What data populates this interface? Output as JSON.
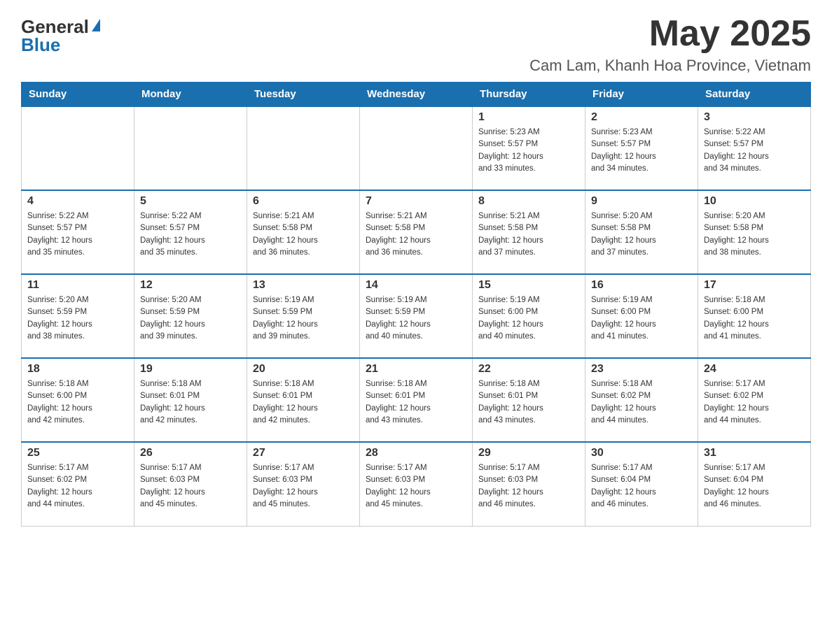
{
  "header": {
    "logo_general": "General",
    "logo_blue": "Blue",
    "month_title": "May 2025",
    "location": "Cam Lam, Khanh Hoa Province, Vietnam"
  },
  "days_of_week": [
    "Sunday",
    "Monday",
    "Tuesday",
    "Wednesday",
    "Thursday",
    "Friday",
    "Saturday"
  ],
  "weeks": [
    [
      {
        "day": "",
        "info": ""
      },
      {
        "day": "",
        "info": ""
      },
      {
        "day": "",
        "info": ""
      },
      {
        "day": "",
        "info": ""
      },
      {
        "day": "1",
        "info": "Sunrise: 5:23 AM\nSunset: 5:57 PM\nDaylight: 12 hours\nand 33 minutes."
      },
      {
        "day": "2",
        "info": "Sunrise: 5:23 AM\nSunset: 5:57 PM\nDaylight: 12 hours\nand 34 minutes."
      },
      {
        "day": "3",
        "info": "Sunrise: 5:22 AM\nSunset: 5:57 PM\nDaylight: 12 hours\nand 34 minutes."
      }
    ],
    [
      {
        "day": "4",
        "info": "Sunrise: 5:22 AM\nSunset: 5:57 PM\nDaylight: 12 hours\nand 35 minutes."
      },
      {
        "day": "5",
        "info": "Sunrise: 5:22 AM\nSunset: 5:57 PM\nDaylight: 12 hours\nand 35 minutes."
      },
      {
        "day": "6",
        "info": "Sunrise: 5:21 AM\nSunset: 5:58 PM\nDaylight: 12 hours\nand 36 minutes."
      },
      {
        "day": "7",
        "info": "Sunrise: 5:21 AM\nSunset: 5:58 PM\nDaylight: 12 hours\nand 36 minutes."
      },
      {
        "day": "8",
        "info": "Sunrise: 5:21 AM\nSunset: 5:58 PM\nDaylight: 12 hours\nand 37 minutes."
      },
      {
        "day": "9",
        "info": "Sunrise: 5:20 AM\nSunset: 5:58 PM\nDaylight: 12 hours\nand 37 minutes."
      },
      {
        "day": "10",
        "info": "Sunrise: 5:20 AM\nSunset: 5:58 PM\nDaylight: 12 hours\nand 38 minutes."
      }
    ],
    [
      {
        "day": "11",
        "info": "Sunrise: 5:20 AM\nSunset: 5:59 PM\nDaylight: 12 hours\nand 38 minutes."
      },
      {
        "day": "12",
        "info": "Sunrise: 5:20 AM\nSunset: 5:59 PM\nDaylight: 12 hours\nand 39 minutes."
      },
      {
        "day": "13",
        "info": "Sunrise: 5:19 AM\nSunset: 5:59 PM\nDaylight: 12 hours\nand 39 minutes."
      },
      {
        "day": "14",
        "info": "Sunrise: 5:19 AM\nSunset: 5:59 PM\nDaylight: 12 hours\nand 40 minutes."
      },
      {
        "day": "15",
        "info": "Sunrise: 5:19 AM\nSunset: 6:00 PM\nDaylight: 12 hours\nand 40 minutes."
      },
      {
        "day": "16",
        "info": "Sunrise: 5:19 AM\nSunset: 6:00 PM\nDaylight: 12 hours\nand 41 minutes."
      },
      {
        "day": "17",
        "info": "Sunrise: 5:18 AM\nSunset: 6:00 PM\nDaylight: 12 hours\nand 41 minutes."
      }
    ],
    [
      {
        "day": "18",
        "info": "Sunrise: 5:18 AM\nSunset: 6:00 PM\nDaylight: 12 hours\nand 42 minutes."
      },
      {
        "day": "19",
        "info": "Sunrise: 5:18 AM\nSunset: 6:01 PM\nDaylight: 12 hours\nand 42 minutes."
      },
      {
        "day": "20",
        "info": "Sunrise: 5:18 AM\nSunset: 6:01 PM\nDaylight: 12 hours\nand 42 minutes."
      },
      {
        "day": "21",
        "info": "Sunrise: 5:18 AM\nSunset: 6:01 PM\nDaylight: 12 hours\nand 43 minutes."
      },
      {
        "day": "22",
        "info": "Sunrise: 5:18 AM\nSunset: 6:01 PM\nDaylight: 12 hours\nand 43 minutes."
      },
      {
        "day": "23",
        "info": "Sunrise: 5:18 AM\nSunset: 6:02 PM\nDaylight: 12 hours\nand 44 minutes."
      },
      {
        "day": "24",
        "info": "Sunrise: 5:17 AM\nSunset: 6:02 PM\nDaylight: 12 hours\nand 44 minutes."
      }
    ],
    [
      {
        "day": "25",
        "info": "Sunrise: 5:17 AM\nSunset: 6:02 PM\nDaylight: 12 hours\nand 44 minutes."
      },
      {
        "day": "26",
        "info": "Sunrise: 5:17 AM\nSunset: 6:03 PM\nDaylight: 12 hours\nand 45 minutes."
      },
      {
        "day": "27",
        "info": "Sunrise: 5:17 AM\nSunset: 6:03 PM\nDaylight: 12 hours\nand 45 minutes."
      },
      {
        "day": "28",
        "info": "Sunrise: 5:17 AM\nSunset: 6:03 PM\nDaylight: 12 hours\nand 45 minutes."
      },
      {
        "day": "29",
        "info": "Sunrise: 5:17 AM\nSunset: 6:03 PM\nDaylight: 12 hours\nand 46 minutes."
      },
      {
        "day": "30",
        "info": "Sunrise: 5:17 AM\nSunset: 6:04 PM\nDaylight: 12 hours\nand 46 minutes."
      },
      {
        "day": "31",
        "info": "Sunrise: 5:17 AM\nSunset: 6:04 PM\nDaylight: 12 hours\nand 46 minutes."
      }
    ]
  ]
}
